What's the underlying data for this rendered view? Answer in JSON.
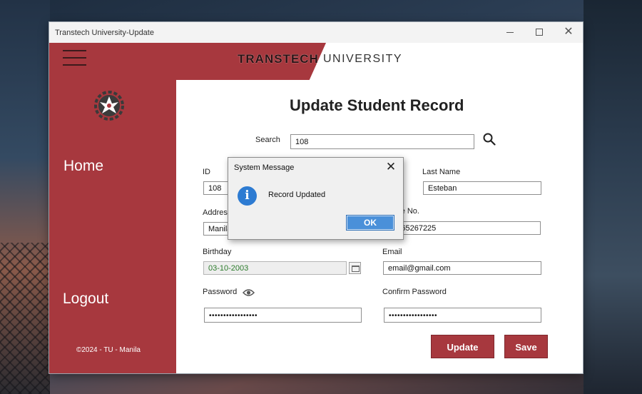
{
  "window": {
    "title": "Transtech University-Update",
    "minimize_symbol": "",
    "maximize_symbol": "",
    "close_symbol": "✕"
  },
  "header": {
    "brand_left": "TRANSTECH",
    "brand_right": "UNIVERSITY"
  },
  "sidebar": {
    "home_label": "Home",
    "logout_label": "Logout",
    "footer": "©2024 - TU - Manila"
  },
  "form": {
    "title": "Update Student Record",
    "search_label": "Search",
    "search_value": "108",
    "id_label": "ID",
    "id_value": "108",
    "last_name_label": "Last Name",
    "last_name_value": "Esteban",
    "address_label": "Address",
    "address_value": "Manila",
    "phone_label": "Phone No.",
    "phone_value": "09565267225",
    "birthday_label": "Birthday",
    "birthday_value": "03-10-2003",
    "email_label": "Email",
    "email_value": "email@gmail.com",
    "password_label": "Password",
    "password_value": "•••••••••••••••••",
    "confirm_password_label": "Confirm Password",
    "confirm_password_value": "•••••••••••••••••",
    "update_button": "Update",
    "save_button": "Save"
  },
  "dialog": {
    "title": "System Message",
    "message": "Record Updated",
    "ok_button": "OK",
    "close_symbol": "✕",
    "info_icon_glyph": "i"
  },
  "colors": {
    "accent": "#a7383e",
    "dialog_ok": "#4a90d9",
    "birthday_text": "#2a7a2a"
  },
  "icons": [
    "hamburger-icon",
    "logo-gear-phoenix-icon",
    "search-icon",
    "eye-icon",
    "calendar-icon",
    "info-icon"
  ]
}
